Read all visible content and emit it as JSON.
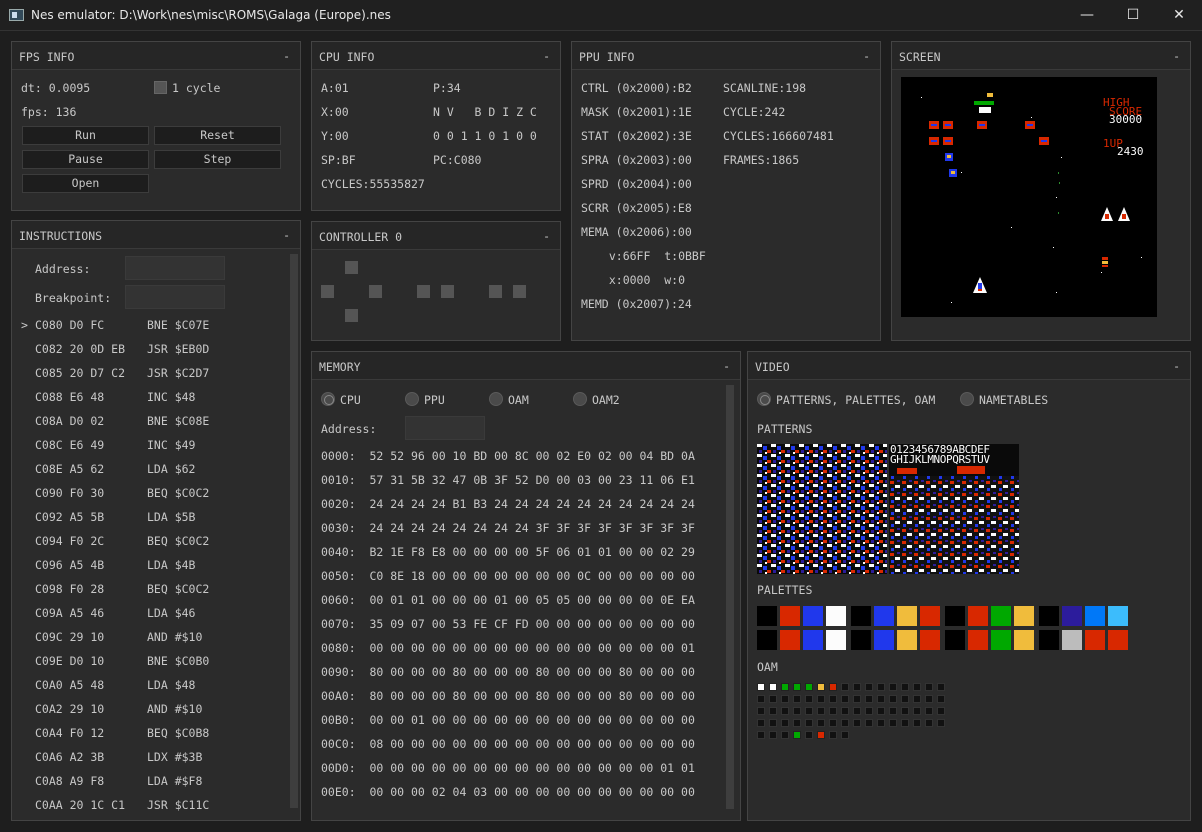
{
  "window": {
    "title": "Nes emulator: D:\\Work\\nes\\misc\\ROMS\\Galaga (Europe).nes",
    "minimize": "—",
    "maximize": "☐",
    "close": "✕"
  },
  "fps": {
    "title": "FPS INFO",
    "collapse": "-",
    "dt": "dt: 0.0095",
    "cycle_label": "1 cycle",
    "fps": "fps: 136",
    "buttons": {
      "run": "Run",
      "reset": "Reset",
      "pause": "Pause",
      "step": "Step",
      "open": "Open"
    }
  },
  "cpu": {
    "title": "CPU INFO",
    "collapse": "-",
    "a": "A:01",
    "p": "P:34",
    "x": "X:00",
    "flags": "N V   B D I Z C",
    "y": "Y:00",
    "flagbits": "0 0 1 1 0 1 0 0",
    "sp": "SP:BF",
    "pc": "PC:C080",
    "cycles": "CYCLES:55535827"
  },
  "ppu": {
    "title": "PPU INFO",
    "collapse": "-",
    "left": [
      "CTRL (0x2000):B2",
      "MASK (0x2001):1E",
      "STAT (0x2002):3E",
      "SPRA (0x2003):00",
      "SPRD (0x2004):00",
      "SCRR (0x2005):E8",
      "MEMA (0x2006):00",
      "  v:66FF  t:0BBF",
      "  x:0000  w:0",
      "MEMD (0x2007):24"
    ],
    "right": [
      "SCANLINE:198",
      "CYCLE:242",
      "CYCLES:166607481",
      "FRAMES:1865"
    ]
  },
  "screen": {
    "title": "SCREEN",
    "collapse": "-",
    "high": "HIGH",
    "score": "SCORE",
    "hiscore": "30000",
    "oneup": "1UP",
    "score1": "2430"
  },
  "controller": {
    "title": "CONTROLLER 0",
    "collapse": "-"
  },
  "instructions": {
    "title": "INSTRUCTIONS",
    "collapse": "-",
    "address_label": "Address:",
    "breakpoint_label": "Breakpoint:",
    "cursor": ">",
    "rows": [
      [
        "C080 D0 FC",
        "BNE $C07E"
      ],
      [
        "C082 20 0D EB",
        "JSR $EB0D"
      ],
      [
        "C085 20 D7 C2",
        "JSR $C2D7"
      ],
      [
        "C088 E6 48",
        "INC $48"
      ],
      [
        "C08A D0 02",
        "BNE $C08E"
      ],
      [
        "C08C E6 49",
        "INC $49"
      ],
      [
        "C08E A5 62",
        "LDA $62"
      ],
      [
        "C090 F0 30",
        "BEQ $C0C2"
      ],
      [
        "C092 A5 5B",
        "LDA $5B"
      ],
      [
        "C094 F0 2C",
        "BEQ $C0C2"
      ],
      [
        "C096 A5 4B",
        "LDA $4B"
      ],
      [
        "C098 F0 28",
        "BEQ $C0C2"
      ],
      [
        "C09A A5 46",
        "LDA $46"
      ],
      [
        "C09C 29 10",
        "AND #$10"
      ],
      [
        "C09E D0 10",
        "BNE $C0B0"
      ],
      [
        "C0A0 A5 48",
        "LDA $48"
      ],
      [
        "C0A2 29 10",
        "AND #$10"
      ],
      [
        "C0A4 F0 12",
        "BEQ $C0B8"
      ],
      [
        "C0A6 A2 3B",
        "LDX #$3B"
      ],
      [
        "C0A8 A9 F8",
        "LDA #$F8"
      ],
      [
        "C0AA 20 1C C1",
        "JSR $C11C"
      ]
    ]
  },
  "memory": {
    "title": "MEMORY",
    "collapse": "-",
    "radios": [
      "CPU",
      "PPU",
      "OAM",
      "OAM2"
    ],
    "address_label": "Address:",
    "rows": [
      "0000:  52 52 96 00 10 BD 00 8C 00 02 E0 02 00 04 BD 0A",
      "0010:  57 31 5B 32 47 0B 3F 52 D0 00 03 00 23 11 06 E1",
      "0020:  24 24 24 24 B1 B3 24 24 24 24 24 24 24 24 24 24",
      "0030:  24 24 24 24 24 24 24 24 3F 3F 3F 3F 3F 3F 3F 3F",
      "0040:  B2 1E F8 E8 00 00 00 00 5F 06 01 01 00 00 02 29",
      "0050:  C0 8E 18 00 00 00 00 00 00 00 0C 00 00 00 00 00",
      "0060:  00 01 01 00 00 00 01 00 05 05 00 00 00 00 0E EA",
      "0070:  35 09 07 00 53 FE CF FD 00 00 00 00 00 00 00 00",
      "0080:  00 00 00 00 00 00 00 00 00 00 00 00 00 00 00 01",
      "0090:  80 00 00 00 80 00 00 00 80 00 00 00 80 00 00 00",
      "00A0:  80 00 00 00 80 00 00 00 80 00 00 00 80 00 00 00",
      "00B0:  00 00 01 00 00 00 00 00 00 00 00 00 00 00 00 00",
      "00C0:  08 00 00 00 00 00 00 00 00 00 00 00 00 00 00 00",
      "00D0:  00 00 00 00 00 00 00 00 00 00 00 00 00 00 01 01",
      "00E0:  00 00 00 02 04 03 00 00 00 00 00 00 00 00 00 00"
    ]
  },
  "video": {
    "title": "VIDEO",
    "collapse": "-",
    "radio_patterns": "PATTERNS, PALETTES, OAM",
    "radio_nametables": "NAMETABLES",
    "patterns_label": "PATTERNS",
    "palettes_label": "PALETTES",
    "oam_label": "OAM",
    "pattern_text1": "0123456789ABCDEF",
    "pattern_text2": "GHIJKLMNOPQRSTUV",
    "palette_row1": [
      "#000000",
      "#d82800",
      "#2038ec",
      "#fcfcfc",
      "#000000",
      "#2038ec",
      "#f0bc3c",
      "#d82800",
      "#000000",
      "#d82800",
      "#00a800",
      "#f0bc3c",
      "#000000",
      "#2c1c9c",
      "#0078f8",
      "#3cbcfc"
    ],
    "palette_row2": [
      "#000000",
      "#d82800",
      "#2038ec",
      "#fcfcfc",
      "#000000",
      "#2038ec",
      "#f0bc3c",
      "#d82800",
      "#000000",
      "#d82800",
      "#00a800",
      "#f0bc3c",
      "#000000",
      "#bcbcbc",
      "#d82800",
      "#d82800"
    ]
  }
}
